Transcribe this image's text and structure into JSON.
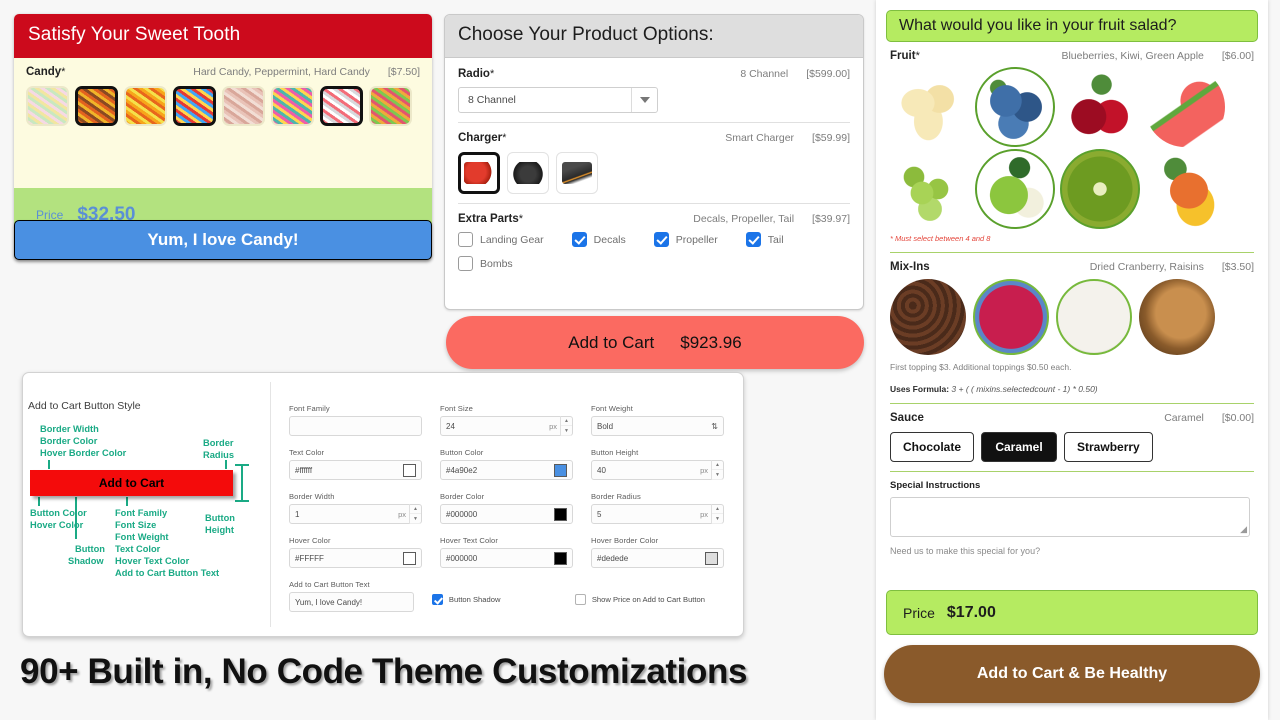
{
  "candy_widget": {
    "header": "Satisfy Your Sweet Tooth",
    "option_label": "Candy",
    "required_mark": "*",
    "selected_summary": "Hard Candy, Peppermint, Hard Candy",
    "option_price": "[$7.50]",
    "swatches": [
      {
        "name": "mixed-pastel-candy",
        "selected": false,
        "c1": "#f6d9e4",
        "c2": "#c9e8c0",
        "c3": "#f2e6a0"
      },
      {
        "name": "hard-candy",
        "selected": true,
        "c1": "#e2621f",
        "c2": "#8a4a22",
        "c3": "#f0b429"
      },
      {
        "name": "candy-corn",
        "selected": false,
        "c1": "#f7a61b",
        "c2": "#f5e04a",
        "c3": "#e8661c"
      },
      {
        "name": "peppermint-sprinkles",
        "selected": true,
        "c1": "#e53935",
        "c2": "#ffd54f",
        "c3": "#42a5f5"
      },
      {
        "name": "taffy",
        "selected": false,
        "c1": "#e9c3b8",
        "c2": "#d9a79a",
        "c3": "#f2ded5"
      },
      {
        "name": "rainbow-candy",
        "selected": false,
        "c1": "#ef5da8",
        "c2": "#4db6ac",
        "c3": "#ffd54f"
      },
      {
        "name": "candy-canes",
        "selected": true,
        "c1": "#f36c78",
        "c2": "#ffffff",
        "c3": "#d8d8dc"
      },
      {
        "name": "gummy-worms",
        "selected": false,
        "c1": "#e2556e",
        "c2": "#7ec850",
        "c3": "#f0a93b"
      }
    ],
    "price_label": "Price",
    "price_value": "$32.50",
    "cta_label": "Yum, I love Candy!",
    "colors": {
      "header_bg": "#cc0a1c",
      "body_bg": "#fdfbe0",
      "price_bg": "#b3e27f",
      "price_text": "#5a8fd6",
      "cta_bg": "#4a90e2"
    }
  },
  "product_widget": {
    "header": "Choose Your Product Options:",
    "sections": [
      {
        "label": "Radio",
        "required_mark": "*",
        "selected_summary": "8 Channel",
        "price": "[$599.00]",
        "control": "select",
        "select_value": "8 Channel"
      },
      {
        "label": "Charger",
        "required_mark": "*",
        "selected_summary": "Smart Charger",
        "price": "[$59.99]",
        "control": "image-swatch",
        "swatches": [
          {
            "name": "smart-charger-red",
            "selected": true
          },
          {
            "name": "charger-black-round",
            "selected": false
          },
          {
            "name": "charger-black-boxy",
            "selected": false
          }
        ]
      },
      {
        "label": "Extra Parts",
        "required_mark": "*",
        "selected_summary": "Decals, Propeller, Tail",
        "price": "[$39.97]",
        "control": "checkbox",
        "checkboxes": [
          {
            "label": "Landing Gear",
            "checked": false
          },
          {
            "label": "Decals",
            "checked": true
          },
          {
            "label": "Propeller",
            "checked": true
          },
          {
            "label": "Tail",
            "checked": true
          },
          {
            "label": "Bombs",
            "checked": false
          }
        ]
      }
    ],
    "cta_label": "Add to Cart",
    "cta_price": "$923.96",
    "colors": {
      "header_bg": "#dedede",
      "cta_bg": "#fb6a61"
    }
  },
  "style_editor": {
    "title": "Add to Cart Button Style",
    "demo_button_label": "Add to Cart",
    "annotations": {
      "top_left": [
        "Border Width",
        "Border Color",
        "Hover Border Color"
      ],
      "top_right": [
        "Border",
        "Radius"
      ],
      "bottom_left": [
        "Button Color",
        "Hover Color"
      ],
      "bottom_center": [
        "Button",
        "Shadow"
      ],
      "bottom_mid": [
        "Font Family",
        "Font Size",
        "Font Weight",
        "Text Color",
        "Hover Text Color",
        "Add to Cart Button Text"
      ],
      "bottom_right": [
        "Button",
        "Height"
      ]
    },
    "fields": [
      {
        "label": "Font Family",
        "value": "",
        "type": "text"
      },
      {
        "label": "Font Size",
        "value": "24",
        "unit": "px",
        "type": "number"
      },
      {
        "label": "Font Weight",
        "value": "Bold",
        "type": "select"
      },
      {
        "label": "Text Color",
        "value": "#ffffff",
        "type": "color",
        "swatch": "#ffffff"
      },
      {
        "label": "Button Color",
        "value": "#4a90e2",
        "type": "color",
        "swatch": "#4a90e2"
      },
      {
        "label": "Button Height",
        "value": "40",
        "unit": "px",
        "type": "number"
      },
      {
        "label": "Border Width",
        "value": "1",
        "unit": "px",
        "type": "number"
      },
      {
        "label": "Border Color",
        "value": "#000000",
        "type": "color",
        "swatch": "#000000"
      },
      {
        "label": "Border Radius",
        "value": "5",
        "unit": "px",
        "type": "number"
      },
      {
        "label": "Hover Color",
        "value": "#FFFFF",
        "type": "color",
        "swatch": "#ffffff"
      },
      {
        "label": "Hover Text Color",
        "value": "#000000",
        "type": "color",
        "swatch": "#000000"
      },
      {
        "label": "Hover Border Color",
        "value": "#dedede",
        "type": "color",
        "swatch": "#dedede"
      },
      {
        "label": "Add to Cart Button Text",
        "value": "Yum, I love Candy!",
        "type": "text"
      }
    ],
    "checkboxes": [
      {
        "label": "Button Shadow",
        "checked": true
      },
      {
        "label": "Show Price on Add to Cart Button",
        "checked": false
      }
    ]
  },
  "headline": "90+ Built in, No Code Theme Customizations",
  "fruit_widget": {
    "header": "What would you like in your fruit salad?",
    "fruit": {
      "label": "Fruit",
      "required_mark": "*",
      "selected_summary": "Blueberries, Kiwi, Green Apple",
      "price": "[$6.00]",
      "items": [
        {
          "name": "banana",
          "selected": false
        },
        {
          "name": "blueberries",
          "selected": true
        },
        {
          "name": "cherries",
          "selected": false
        },
        {
          "name": "watermelon",
          "selected": false
        },
        {
          "name": "grapes",
          "selected": false
        },
        {
          "name": "green-apple",
          "selected": true
        },
        {
          "name": "kiwi",
          "selected": true
        },
        {
          "name": "mango",
          "selected": false
        }
      ],
      "validation_note": "* Must select between 4 and 8"
    },
    "mixins": {
      "label": "Mix-Ins",
      "selected_summary": "Dried Cranberry, Raisins",
      "price": "[$3.50]",
      "items": [
        {
          "name": "chocolate-chips",
          "selected": false
        },
        {
          "name": "dried-cranberry",
          "selected": true
        },
        {
          "name": "raisins",
          "selected": true
        },
        {
          "name": "almonds",
          "selected": false
        }
      ],
      "note": "First topping $3. Additional toppings $0.50 each.",
      "formula_label": "Uses Formula:",
      "formula_value": "3 + ( ( mixins.selectedcount - 1) * 0.50)"
    },
    "sauce": {
      "label": "Sauce",
      "selected_summary": "Caramel",
      "price": "[$0.00]",
      "options": [
        {
          "label": "Chocolate",
          "active": false
        },
        {
          "label": "Caramel",
          "active": true
        },
        {
          "label": "Strawberry",
          "active": false
        }
      ]
    },
    "special_instructions": {
      "label": "Special Instructions",
      "value": "",
      "help": "Need us to make this special for you?"
    },
    "price_label": "Price",
    "price_value": "$17.00",
    "cta_label": "Add to Cart & Be Healthy",
    "colors": {
      "header_bg": "#b5eb61",
      "cta_bg": "#8a5a2b",
      "accent": "#7fbf3f"
    }
  }
}
